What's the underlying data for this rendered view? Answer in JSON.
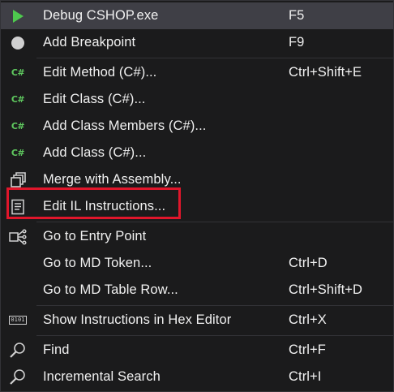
{
  "menu": {
    "items": [
      {
        "label": "Debug CSHOP.exe",
        "shortcut": "F5",
        "icon": "play-icon"
      },
      {
        "label": "Add Breakpoint",
        "shortcut": "F9",
        "icon": "breakpoint-icon"
      },
      {
        "label": "Edit Method (C#)...",
        "shortcut": "Ctrl+Shift+E",
        "icon": "csharp-icon",
        "icon_text": "C#"
      },
      {
        "label": "Edit Class (C#)...",
        "shortcut": "",
        "icon": "csharp-icon",
        "icon_text": "C#"
      },
      {
        "label": "Add Class Members (C#)...",
        "shortcut": "",
        "icon": "csharp-icon",
        "icon_text": "C#"
      },
      {
        "label": "Add Class (C#)...",
        "shortcut": "",
        "icon": "csharp-icon",
        "icon_text": "C#"
      },
      {
        "label": "Merge with Assembly...",
        "shortcut": "",
        "icon": "merge-assembly-icon"
      },
      {
        "label": "Edit IL Instructions...",
        "shortcut": "",
        "icon": "document-icon"
      },
      {
        "label": "Go to Entry Point",
        "shortcut": "",
        "icon": "entry-point-icon"
      },
      {
        "label": "Go to MD Token...",
        "shortcut": "Ctrl+D",
        "icon": ""
      },
      {
        "label": "Go to MD Table Row...",
        "shortcut": "Ctrl+Shift+D",
        "icon": ""
      },
      {
        "label": "Show Instructions in Hex Editor",
        "shortcut": "Ctrl+X",
        "icon": "hex-editor-icon",
        "icon_text": "0101"
      },
      {
        "label": "Find",
        "shortcut": "Ctrl+F",
        "icon": "search-icon"
      },
      {
        "label": "Incremental Search",
        "shortcut": "Ctrl+I",
        "icon": "search-icon"
      }
    ]
  },
  "colors": {
    "menu_bg": "#1b1b1c",
    "highlight_bg": "#3f3f46",
    "text": "#f1f1f1",
    "play_green": "#4ec94e",
    "csharp_green": "#5fc95f",
    "annotation_red": "#e0162b"
  }
}
